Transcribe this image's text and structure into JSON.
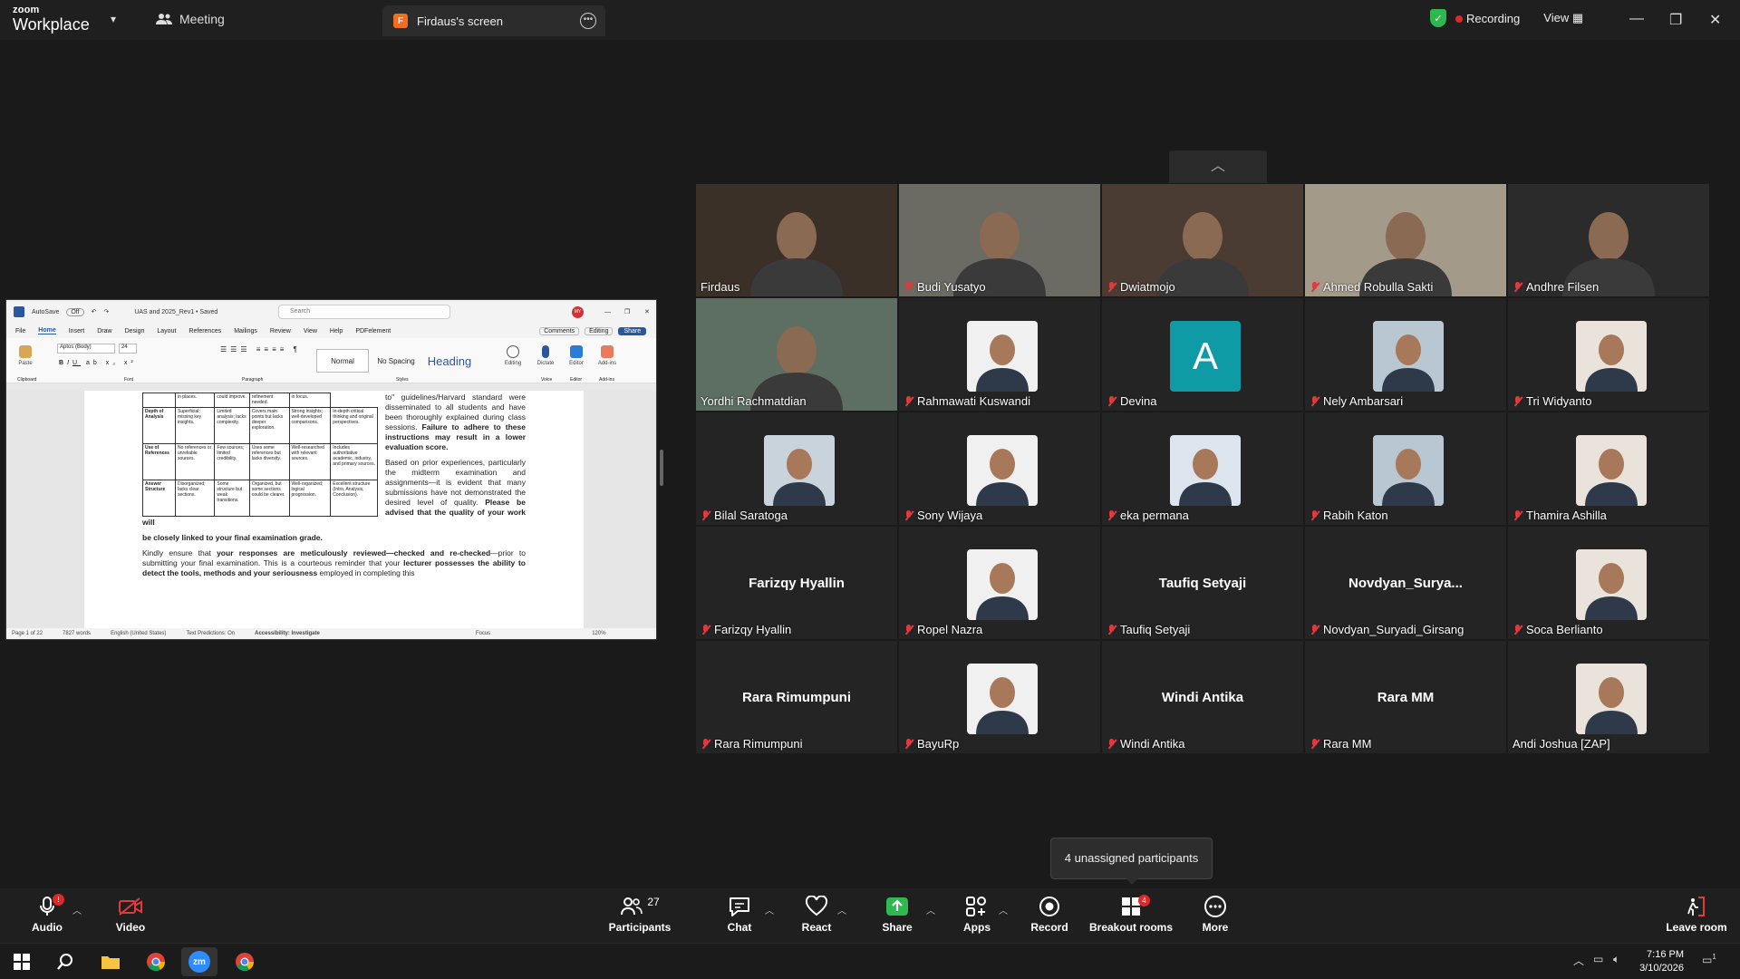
{
  "app": {
    "brand_line1": "zoom",
    "brand_line2": "Workplace",
    "meeting_tab": "Meeting",
    "screen_tab": "Firdaus's screen",
    "screen_badge": "F",
    "recording": "Recording",
    "view": "View"
  },
  "word": {
    "autosave": "AutoSave",
    "autosave_state": "Off",
    "doc_title": "UAS and 2025_Rev1 • Saved",
    "search_placeholder": "Search",
    "user_initials": "MY",
    "menu": [
      "File",
      "Home",
      "Insert",
      "Draw",
      "Design",
      "Layout",
      "References",
      "Mailings",
      "Review",
      "View",
      "Help",
      "PDFelement"
    ],
    "comments": "Comments",
    "editing": "Editing",
    "share": "Share",
    "font_name": "Aptos (Body)",
    "font_size": "24",
    "style_normal": "Normal",
    "style_nospacing": "No Spacing",
    "style_heading": "Heading",
    "btn_editing": "Editing",
    "btn_dictate": "Dictate",
    "btn_editor": "Editor",
    "btn_addins": "Add-ins",
    "group_clipboard": "Clipboard",
    "group_font": "Font",
    "group_paragraph": "Paragraph",
    "group_styles": "Styles",
    "group_voice": "Voice",
    "group_editor": "Editor",
    "group_addins": "Add-ins",
    "paste": "Paste",
    "table_top": [
      "in places.",
      "could improve.",
      "refinement needed.",
      "in focus."
    ],
    "rows": [
      {
        "head": "Depth of Analysis",
        "c1": "Superficial; missing key insights.",
        "c2": "Limited analysis; lacks complexity.",
        "c3": "Covers main points but lacks deeper exploration.",
        "c4": "Strong insights; well-developed comparisons.",
        "c5": "In-depth critical thinking and original perspectives."
      },
      {
        "head": "Use of References",
        "c1": "No references or unreliable sources.",
        "c2": "Few sources; limited credibility.",
        "c3": "Uses some references but lacks diversity.",
        "c4": "Well-researched with relevant sources.",
        "c5": "Includes authoritative academic, industry, and primary sources."
      },
      {
        "head": "Answer Structure",
        "c1": "Disorganized; lacks clear sections.",
        "c2": "Some structure but weak transitions.",
        "c3": "Organized, but some sections could be clearer.",
        "c4": "Well-organized; logical progression.",
        "c5": "Excellent structure (Intro, Analysis, Conclusion)."
      }
    ],
    "side_p1": "to\" guidelines/Harvard standard were disseminated to all students and have been thoroughly explained during class sessions.",
    "side_p1_bold": "Failure to adhere to these instructions may result in a lower evaluation score.",
    "side_p2": "Based on prior experiences, particularly the midterm examination and assignments—it is evident that many submissions have not demonstrated the desired level of quality.",
    "side_p2_bold": "Please be advised that the quality of your work will",
    "full_bold": "be closely linked to your final examination grade.",
    "p3_a": "Kindly ensure that ",
    "p3_b": "your responses are meticulously reviewed—checked and re-checked",
    "p3_c": "—prior to submitting your final examination. This is a courteous reminder that your ",
    "p3_d": "lecturer possesses the ability to detect the tools, methods and your seriousness",
    "p3_e": " employed in completing this",
    "status_page": "Page 1 of 22",
    "status_words": "7827 words",
    "status_lang": "English (United States)",
    "status_text_pred": "Text Predictions: On",
    "status_access": "Accessibility: Investigate",
    "status_focus": "Focus",
    "status_zoom": "120%"
  },
  "participants": [
    {
      "name": "Firdaus",
      "muted": false,
      "kind": "video"
    },
    {
      "name": "Budi Yusatyo",
      "muted": true,
      "kind": "video"
    },
    {
      "name": "Dwiatmojo",
      "muted": true,
      "kind": "video"
    },
    {
      "name": "Ahmed Robulla Sakti",
      "muted": true,
      "kind": "video"
    },
    {
      "name": "Andhre Filsen",
      "muted": true,
      "kind": "video"
    },
    {
      "name": "Yordhi Rachmatdian",
      "muted": false,
      "kind": "video"
    },
    {
      "name": "Rahmawati Kuswandi",
      "muted": true,
      "kind": "photo"
    },
    {
      "name": "Devina",
      "muted": true,
      "kind": "letter",
      "letter": "A"
    },
    {
      "name": "Nely Ambarsari",
      "muted": true,
      "kind": "photo"
    },
    {
      "name": "Tri Widyanto",
      "muted": true,
      "kind": "photo"
    },
    {
      "name": "Bilal Saratoga",
      "muted": true,
      "kind": "photo"
    },
    {
      "name": "Sony Wijaya",
      "muted": true,
      "kind": "photo"
    },
    {
      "name": "eka permana",
      "muted": true,
      "kind": "photo"
    },
    {
      "name": "Rabih Katon",
      "muted": true,
      "kind": "photo"
    },
    {
      "name": "Thamira Ashilla",
      "muted": true,
      "kind": "photo"
    },
    {
      "name": "Farizqy Hyallin",
      "muted": true,
      "kind": "name",
      "big": "Farizqy Hyallin"
    },
    {
      "name": "Ropel Nazra",
      "muted": true,
      "kind": "photo"
    },
    {
      "name": "Taufiq Setyaji",
      "muted": true,
      "kind": "name",
      "big": "Taufiq Setyaji"
    },
    {
      "name": "Novdyan_Suryadi_Girsang",
      "muted": true,
      "kind": "name",
      "big": "Novdyan_Surya..."
    },
    {
      "name": "Soca Berlianto",
      "muted": true,
      "kind": "photo"
    },
    {
      "name": "Rara Rimumpuni",
      "muted": true,
      "kind": "name",
      "big": "Rara Rimumpuni"
    },
    {
      "name": "BayuRp",
      "muted": true,
      "kind": "photo"
    },
    {
      "name": "Windi Antika",
      "muted": true,
      "kind": "name",
      "big": "Windi Antika"
    },
    {
      "name": "Rara MM",
      "muted": true,
      "kind": "name",
      "big": "Rara MM"
    },
    {
      "name": "Andi Joshua [ZAP]",
      "muted": false,
      "kind": "photo"
    }
  ],
  "tooltip": "4 unassigned participants",
  "toolbar": {
    "audio": "Audio",
    "audio_badge": "!",
    "video": "Video",
    "participants": "Participants",
    "participants_count": "27",
    "chat": "Chat",
    "react": "React",
    "share": "Share",
    "apps": "Apps",
    "record": "Record",
    "breakout": "Breakout rooms",
    "breakout_badge": "4",
    "more": "More",
    "leave": "Leave room"
  },
  "taskbar": {
    "time": "7:16 PM",
    "date": "3/10/2026",
    "zoom_label": "zm",
    "notif_count": "1"
  },
  "colors": {
    "active_speaker": "#2ecc71",
    "muted_red": "#e03a3a",
    "share_green": "#2eb84f",
    "devina_avatar": "#0e9ba5"
  }
}
